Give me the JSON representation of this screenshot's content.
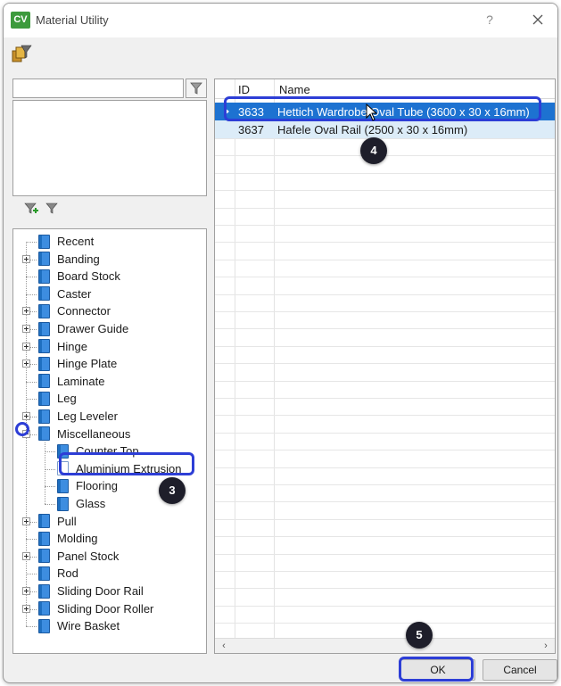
{
  "window": {
    "title": "Material Utility",
    "logo_text": "CV",
    "help": "?"
  },
  "colors": {
    "selection": "#1d72d1",
    "alt_row": "#dcecf8",
    "callout": "#2d3ed6",
    "logo": "#3c9a3c"
  },
  "filter": {
    "value": "",
    "placeholder": ""
  },
  "tree": {
    "items": [
      {
        "label": "Recent",
        "expandable": false
      },
      {
        "label": "Banding",
        "expandable": true
      },
      {
        "label": "Board Stock",
        "expandable": false
      },
      {
        "label": "Caster",
        "expandable": false
      },
      {
        "label": "Connector",
        "expandable": true
      },
      {
        "label": "Drawer Guide",
        "expandable": true
      },
      {
        "label": "Hinge",
        "expandable": true
      },
      {
        "label": "Hinge Plate",
        "expandable": true
      },
      {
        "label": "Laminate",
        "expandable": false
      },
      {
        "label": "Leg",
        "expandable": false
      },
      {
        "label": "Leg Leveler",
        "expandable": true
      },
      {
        "label": "Miscellaneous",
        "expandable": true,
        "expanded": true
      },
      {
        "label": "Counter Top",
        "child": true
      },
      {
        "label": "Aluminium Extrusion",
        "child": true,
        "selected": true
      },
      {
        "label": "Flooring",
        "child": true
      },
      {
        "label": "Glass",
        "child": true
      },
      {
        "label": "Pull",
        "expandable": true
      },
      {
        "label": "Molding",
        "expandable": false
      },
      {
        "label": "Panel Stock",
        "expandable": true
      },
      {
        "label": "Rod",
        "expandable": false
      },
      {
        "label": "Sliding Door Rail",
        "expandable": true
      },
      {
        "label": "Sliding Door Roller",
        "expandable": true
      },
      {
        "label": "Wire Basket",
        "expandable": false
      }
    ]
  },
  "grid": {
    "columns": [
      "ID",
      "Name"
    ],
    "rows": [
      {
        "id": "3633",
        "name": "Hettich Wardrobe Oval Tube (3600 x 30 x 16mm)",
        "selected": true
      },
      {
        "id": "3637",
        "name": "Hafele Oval Rail (2500 x 30 x 16mm)",
        "selected": false
      }
    ]
  },
  "buttons": {
    "ok": "OK",
    "cancel": "Cancel"
  },
  "callouts": {
    "three": "3",
    "four": "4",
    "five": "5"
  },
  "icons": [
    "material-filter-icon",
    "filter-icon",
    "add-filter-icon",
    "remove-filter-icon",
    "close-icon",
    "book-icon"
  ]
}
